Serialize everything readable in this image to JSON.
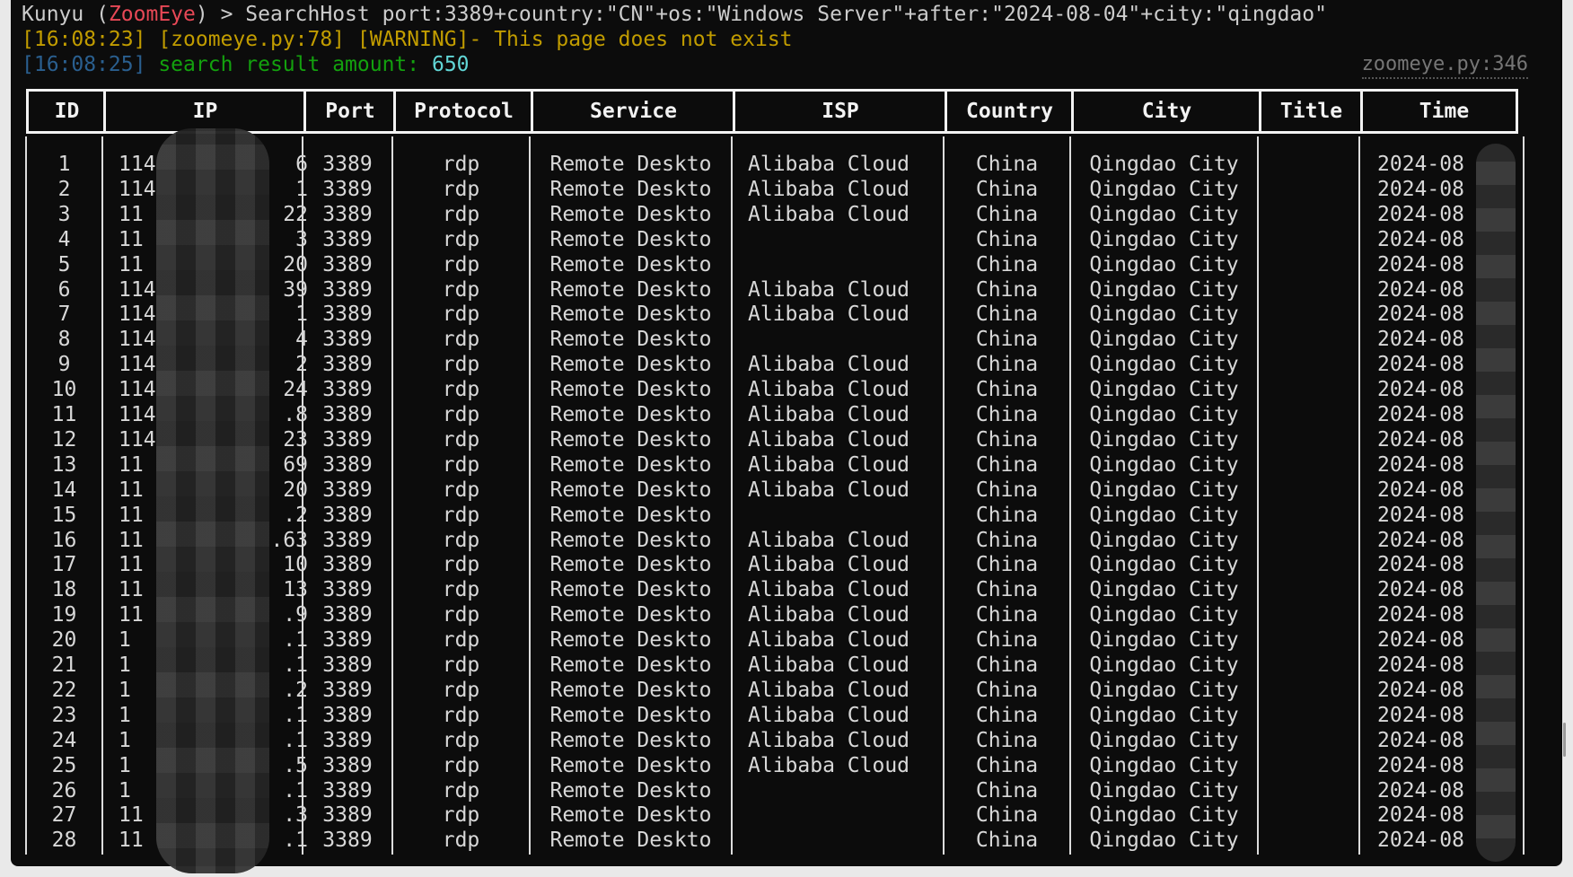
{
  "console": {
    "prompt_prefix": "Kunyu (",
    "prompt_brand": "ZoomEye",
    "prompt_suffix": ") > SearchHost port:3389+country:\"CN\"+os:\"Windows Server\"+after:\"2024-08-04\"+city:\"qingdao\"",
    "warning": "[16:08:23] [zoomeye.py:78] [WARNING]- This page does not exist",
    "result_time": "[16:08:25]",
    "result_label": " search result amount: ",
    "result_count": "650",
    "source_ref": "zoomeye.py:346"
  },
  "colors": {
    "background": "#0c0c0c",
    "brand": "#e74856",
    "warning": "#c19c00",
    "label": "#13a10e",
    "count": "#61d6d6"
  },
  "table": {
    "headers": [
      "ID",
      "IP",
      "Port",
      "Protocol",
      "Service",
      "ISP",
      "Country",
      "City",
      "Title",
      "Time"
    ],
    "rows": [
      [
        "1",
        "114",
        "6",
        "3389",
        "rdp",
        "Remote Deskto",
        "Alibaba Cloud",
        "China",
        "Qingdao City",
        "",
        "2024-08"
      ],
      [
        "2",
        "114",
        "1",
        "3389",
        "rdp",
        "Remote Deskto",
        "Alibaba Cloud",
        "China",
        "Qingdao City",
        "",
        "2024-08"
      ],
      [
        "3",
        "11",
        "22",
        "3389",
        "rdp",
        "Remote Deskto",
        "Alibaba Cloud",
        "China",
        "Qingdao City",
        "",
        "2024-08"
      ],
      [
        "4",
        "11",
        "3",
        "3389",
        "rdp",
        "Remote Deskto",
        "",
        "China",
        "Qingdao City",
        "",
        "2024-08"
      ],
      [
        "5",
        "11",
        "20",
        "3389",
        "rdp",
        "Remote Deskto",
        "",
        "China",
        "Qingdao City",
        "",
        "2024-08"
      ],
      [
        "6",
        "114",
        "39",
        "3389",
        "rdp",
        "Remote Deskto",
        "Alibaba Cloud",
        "China",
        "Qingdao City",
        "",
        "2024-08"
      ],
      [
        "7",
        "114",
        "1",
        "3389",
        "rdp",
        "Remote Deskto",
        "Alibaba Cloud",
        "China",
        "Qingdao City",
        "",
        "2024-08"
      ],
      [
        "8",
        "114",
        "4",
        "3389",
        "rdp",
        "Remote Deskto",
        "",
        "China",
        "Qingdao City",
        "",
        "2024-08"
      ],
      [
        "9",
        "114",
        "2",
        "3389",
        "rdp",
        "Remote Deskto",
        "Alibaba Cloud",
        "China",
        "Qingdao City",
        "",
        "2024-08"
      ],
      [
        "10",
        "114",
        "24",
        "3389",
        "rdp",
        "Remote Deskto",
        "Alibaba Cloud",
        "China",
        "Qingdao City",
        "",
        "2024-08"
      ],
      [
        "11",
        "114",
        ".8",
        "3389",
        "rdp",
        "Remote Deskto",
        "Alibaba Cloud",
        "China",
        "Qingdao City",
        "",
        "2024-08"
      ],
      [
        "12",
        "114",
        "23",
        "3389",
        "rdp",
        "Remote Deskto",
        "Alibaba Cloud",
        "China",
        "Qingdao City",
        "",
        "2024-08"
      ],
      [
        "13",
        "11",
        "69",
        "3389",
        "rdp",
        "Remote Deskto",
        "Alibaba Cloud",
        "China",
        "Qingdao City",
        "",
        "2024-08"
      ],
      [
        "14",
        "11",
        "20",
        "3389",
        "rdp",
        "Remote Deskto",
        "Alibaba Cloud",
        "China",
        "Qingdao City",
        "",
        "2024-08"
      ],
      [
        "15",
        "11",
        ".2",
        "3389",
        "rdp",
        "Remote Deskto",
        "",
        "China",
        "Qingdao City",
        "",
        "2024-08"
      ],
      [
        "16",
        "11",
        ".63",
        "3389",
        "rdp",
        "Remote Deskto",
        "Alibaba Cloud",
        "China",
        "Qingdao City",
        "",
        "2024-08"
      ],
      [
        "17",
        "11",
        "10",
        "3389",
        "rdp",
        "Remote Deskto",
        "Alibaba Cloud",
        "China",
        "Qingdao City",
        "",
        "2024-08"
      ],
      [
        "18",
        "11",
        "13",
        "3389",
        "rdp",
        "Remote Deskto",
        "Alibaba Cloud",
        "China",
        "Qingdao City",
        "",
        "2024-08"
      ],
      [
        "19",
        "11",
        ".9",
        "3389",
        "rdp",
        "Remote Deskto",
        "Alibaba Cloud",
        "China",
        "Qingdao City",
        "",
        "2024-08"
      ],
      [
        "20",
        "1",
        ".1",
        "3389",
        "rdp",
        "Remote Deskto",
        "Alibaba Cloud",
        "China",
        "Qingdao City",
        "",
        "2024-08"
      ],
      [
        "21",
        "1",
        ".1",
        "3389",
        "rdp",
        "Remote Deskto",
        "Alibaba Cloud",
        "China",
        "Qingdao City",
        "",
        "2024-08"
      ],
      [
        "22",
        "1",
        ".2",
        "3389",
        "rdp",
        "Remote Deskto",
        "Alibaba Cloud",
        "China",
        "Qingdao City",
        "",
        "2024-08"
      ],
      [
        "23",
        "1",
        ".1",
        "3389",
        "rdp",
        "Remote Deskto",
        "Alibaba Cloud",
        "China",
        "Qingdao City",
        "",
        "2024-08"
      ],
      [
        "24",
        "1",
        ".1",
        "3389",
        "rdp",
        "Remote Deskto",
        "Alibaba Cloud",
        "China",
        "Qingdao City",
        "",
        "2024-08"
      ],
      [
        "25",
        "1",
        ".5",
        "3389",
        "rdp",
        "Remote Deskto",
        "Alibaba Cloud",
        "China",
        "Qingdao City",
        "",
        "2024-08"
      ],
      [
        "26",
        "1",
        ".1",
        "3389",
        "rdp",
        "Remote Deskto",
        "",
        "China",
        "Qingdao City",
        "",
        "2024-08"
      ],
      [
        "27",
        "11",
        ".3",
        "3389",
        "rdp",
        "Remote Deskto",
        "",
        "China",
        "Qingdao City",
        "",
        "2024-08"
      ],
      [
        "28",
        "11",
        ".1",
        "3389",
        "rdp",
        "Remote Deskto",
        "",
        "China",
        "Qingdao City",
        "",
        "2024-08"
      ]
    ]
  }
}
